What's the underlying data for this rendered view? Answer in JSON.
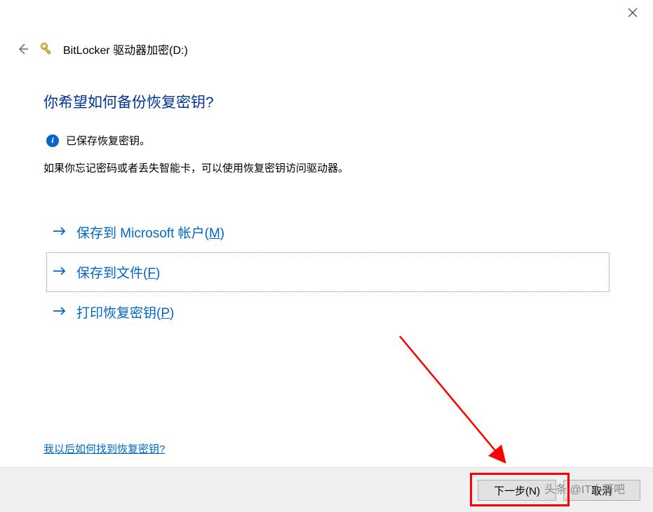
{
  "window": {
    "title": "BitLocker 驱动器加密(D:)"
  },
  "main": {
    "question": "你希望如何备份恢复密钥?",
    "info_text": "已保存恢复密钥。",
    "description": "如果你忘记密码或者丢失智能卡，可以使用恢复密钥访问驱动器。"
  },
  "options": {
    "microsoft_account": {
      "prefix": "保存到 Microsoft 帐户(",
      "hotkey": "M",
      "suffix": ")"
    },
    "save_file": {
      "prefix": "保存到文件(",
      "hotkey": "F",
      "suffix": ")"
    },
    "print_key": {
      "prefix": "打印恢复密钥(",
      "hotkey": "P",
      "suffix": ")"
    }
  },
  "help_link": "我以后如何找到恢复密钥?",
  "footer": {
    "next": "下一步(N)",
    "cancel": "取消"
  },
  "watermark": "头条 @IT小哥吧"
}
